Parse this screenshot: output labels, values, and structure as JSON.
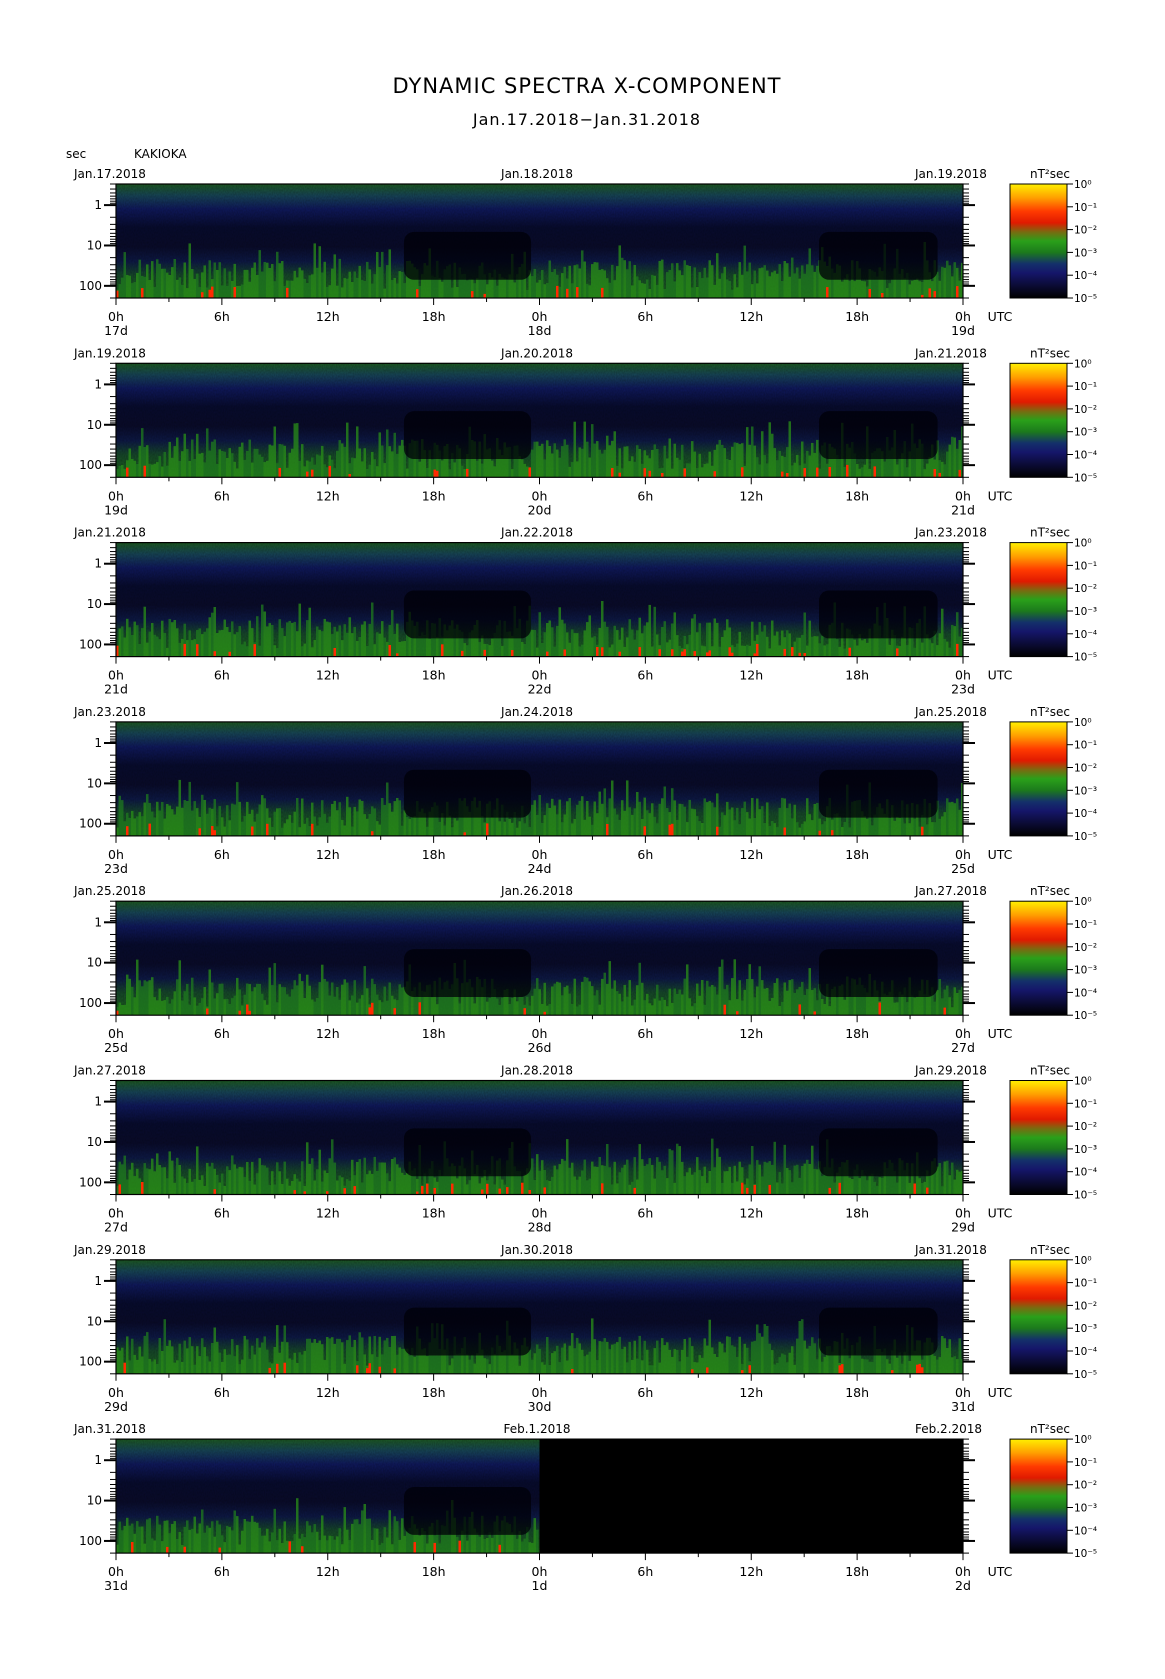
{
  "title": "DYNAMIC SPECTRA X-COMPONENT",
  "subtitle": "Jan.17.2018−Jan.31.2018",
  "y_unit": "sec",
  "station": "KAKIOKA",
  "colorbar_unit": "nT²sec",
  "colors": {
    "background": "#000000",
    "low": "#12124a",
    "mid": "#1f7a1f",
    "high": "#ff2a00",
    "peak": "#ffe000"
  },
  "chart_data": {
    "type": "heatmap",
    "y_axis": {
      "label": "sec",
      "scale": "log",
      "reversed": true,
      "range": [
        0.3,
        200
      ],
      "ticks": [
        1,
        10,
        100
      ],
      "tick_labels": [
        "1",
        "10",
        "100"
      ]
    },
    "colorbar": {
      "unit": "nT²sec",
      "scale": "log",
      "range": [
        1e-05,
        1
      ],
      "tick_labels": [
        "10⁰",
        "10⁻¹",
        "10⁻²",
        "10⁻³",
        "10⁻⁴",
        "10⁻⁵"
      ]
    },
    "x_tick_labels": [
      "0h",
      "6h",
      "12h",
      "18h",
      "0h",
      "6h",
      "12h",
      "18h",
      "0h"
    ],
    "x_unit": "UTC",
    "panels": [
      {
        "start": "Jan.17.2018",
        "mid": "Jan.18.2018",
        "end": "Jan.19.2018",
        "days": [
          "17d",
          "18d",
          "19d"
        ],
        "data_until_hours": 48
      },
      {
        "start": "Jan.19.2018",
        "mid": "Jan.20.2018",
        "end": "Jan.21.2018",
        "days": [
          "19d",
          "20d",
          "21d"
        ],
        "data_until_hours": 48
      },
      {
        "start": "Jan.21.2018",
        "mid": "Jan.22.2018",
        "end": "Jan.23.2018",
        "days": [
          "21d",
          "22d",
          "23d"
        ],
        "data_until_hours": 48
      },
      {
        "start": "Jan.23.2018",
        "mid": "Jan.24.2018",
        "end": "Jan.25.2018",
        "days": [
          "23d",
          "24d",
          "25d"
        ],
        "data_until_hours": 48
      },
      {
        "start": "Jan.25.2018",
        "mid": "Jan.26.2018",
        "end": "Jan.27.2018",
        "days": [
          "25d",
          "26d",
          "27d"
        ],
        "data_until_hours": 48
      },
      {
        "start": "Jan.27.2018",
        "mid": "Jan.28.2018",
        "end": "Jan.29.2018",
        "days": [
          "27d",
          "28d",
          "29d"
        ],
        "data_until_hours": 48
      },
      {
        "start": "Jan.29.2018",
        "mid": "Jan.30.2018",
        "end": "Jan.31.2018",
        "days": [
          "29d",
          "30d",
          "31d"
        ],
        "data_until_hours": 48
      },
      {
        "start": "Jan.31.2018",
        "mid": "Feb.1.2018",
        "end": "Feb.2.2018",
        "days": [
          "31d",
          "1d",
          "2d"
        ],
        "data_until_hours": 24
      }
    ]
  }
}
